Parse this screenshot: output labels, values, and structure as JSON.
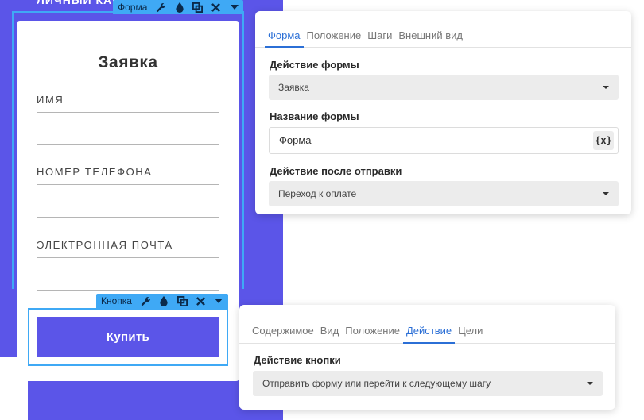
{
  "canvas": {
    "top_cut_text": "ЛИЧНЫЙ КАБИНЕТ"
  },
  "form_toolbar": {
    "label": "Форма",
    "icons": [
      "wrench-icon",
      "drop-icon",
      "duplicate-icon",
      "close-icon",
      "caret-down-icon"
    ]
  },
  "form_card": {
    "title": "Заявка",
    "fields": [
      {
        "label": "ИМЯ",
        "value": ""
      },
      {
        "label": "НОМЕР ТЕЛЕФОНА",
        "value": ""
      },
      {
        "label": "ЭЛЕКТРОННАЯ ПОЧТА",
        "value": ""
      }
    ],
    "submit_label": "Купить"
  },
  "button_toolbar": {
    "label": "Кнопка",
    "icons": [
      "wrench-icon",
      "drop-icon",
      "duplicate-icon",
      "close-icon",
      "caret-down-icon"
    ]
  },
  "form_panel": {
    "tabs": [
      "Форма",
      "Положение",
      "Шаги",
      "Внешний вид"
    ],
    "active_tab": 0,
    "action_label": "Действие формы",
    "action_value": "Заявка",
    "name_label": "Название формы",
    "name_value": "Форма",
    "var_button": "{x}",
    "after_label": "Действие после отправки",
    "after_value": "Переход к оплате"
  },
  "button_panel": {
    "tabs": [
      "Содержимое",
      "Вид",
      "Положение",
      "Действие",
      "Цели"
    ],
    "active_tab": 3,
    "action_label": "Действие кнопки",
    "action_value": "Отправить форму или перейти к следующему шагу"
  },
  "colors": {
    "accent_purple": "#5b55e8",
    "selection_blue": "#3fa9f5",
    "active_tab_blue": "#2b6fd6"
  }
}
